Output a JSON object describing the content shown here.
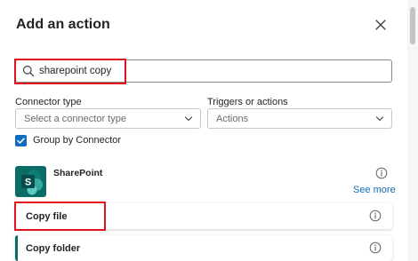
{
  "panel": {
    "title": "Add an action"
  },
  "search": {
    "value": "sharepoint copy",
    "placeholder": ""
  },
  "filters": {
    "connector_type_label": "Connector type",
    "connector_type_value": "Select a connector type",
    "triggers_label": "Triggers or actions",
    "triggers_value": "Actions"
  },
  "group_by": {
    "label": "Group by Connector",
    "checked": true
  },
  "connector": {
    "name": "SharePoint",
    "see_more": "See more",
    "logo_color": "#0b6b66"
  },
  "actions": [
    {
      "label": "Copy file"
    },
    {
      "label": "Copy folder"
    }
  ],
  "colors": {
    "accent": "#0f6cbd",
    "highlight": "#e0121f",
    "sharepoint": "#0b6b66"
  }
}
